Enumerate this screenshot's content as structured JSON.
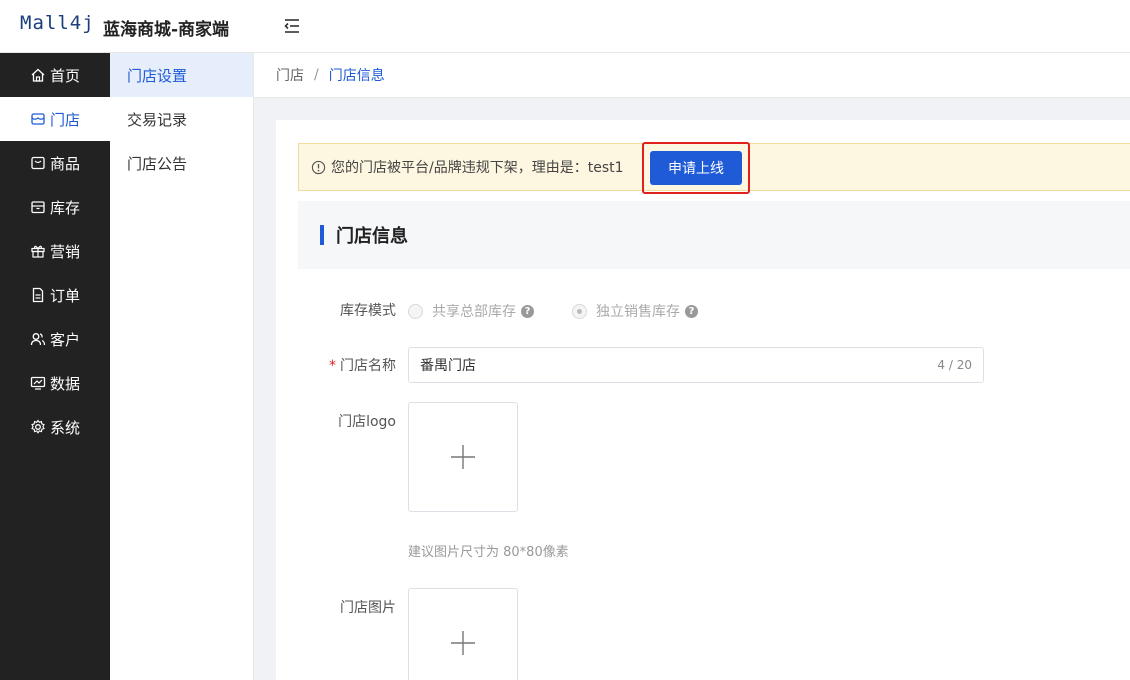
{
  "header": {
    "logo": "Mall4j",
    "title": "蓝海商城-商家端",
    "fold_icon": "menu-fold-icon"
  },
  "sidebar": {
    "items": [
      {
        "label": "首页",
        "icon": "home-icon"
      },
      {
        "label": "门店",
        "icon": "store-icon"
      },
      {
        "label": "商品",
        "icon": "goods-icon"
      },
      {
        "label": "库存",
        "icon": "inventory-icon"
      },
      {
        "label": "营销",
        "icon": "gift-icon"
      },
      {
        "label": "订单",
        "icon": "order-icon"
      },
      {
        "label": "客户",
        "icon": "customer-icon"
      },
      {
        "label": "数据",
        "icon": "chart-icon"
      },
      {
        "label": "系统",
        "icon": "gear-icon"
      }
    ],
    "active_index": 1
  },
  "submenu": {
    "items": [
      {
        "label": "门店设置"
      },
      {
        "label": "交易记录"
      },
      {
        "label": "门店公告"
      }
    ],
    "active_index": 0
  },
  "breadcrumb": {
    "root": "门店",
    "separator": "/",
    "current": "门店信息"
  },
  "alert": {
    "icon": "info-circle-icon",
    "text": "您的门店被平台/品牌违规下架，理由是：test1",
    "button_label": "申请上线"
  },
  "section": {
    "title": "门店信息"
  },
  "form": {
    "stock_mode": {
      "label": "库存模式",
      "options": [
        "共享总部库存",
        "独立销售库存"
      ],
      "selected_index": 1,
      "disabled": true
    },
    "store_name": {
      "label": "门店名称",
      "required_mark": "*",
      "value": "番禺门店",
      "count": "4 / 20"
    },
    "logo": {
      "label": "门店logo",
      "hint": "建议图片尺寸为 80*80像素"
    },
    "images": {
      "label": "门店图片"
    }
  },
  "colors": {
    "primary": "#1f5bd6",
    "sidebar_bg": "#222222",
    "alert_bg": "#fdf6e0",
    "highlight": "#e0211b"
  }
}
